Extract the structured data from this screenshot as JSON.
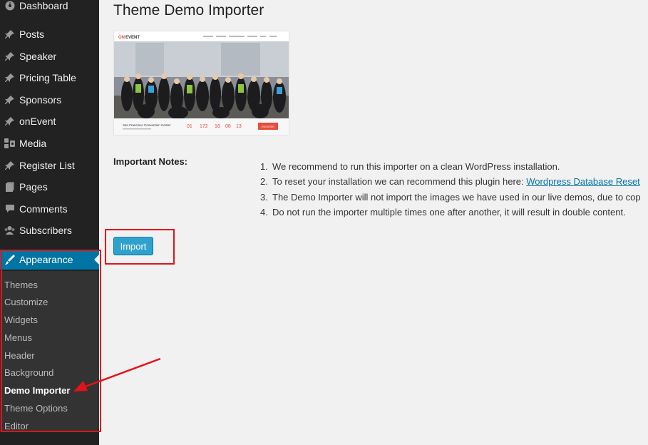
{
  "sidebar": {
    "items": [
      {
        "label": "Dashboard",
        "icon": "dashboard-icon"
      },
      {
        "label": "Posts",
        "icon": "pin-icon"
      },
      {
        "label": "Speaker",
        "icon": "pin-icon"
      },
      {
        "label": "Pricing Table",
        "icon": "pin-icon"
      },
      {
        "label": "Sponsors",
        "icon": "pin-icon"
      },
      {
        "label": "onEvent",
        "icon": "pin-icon"
      },
      {
        "label": "Media",
        "icon": "media-icon"
      },
      {
        "label": "Register List",
        "icon": "pin-icon"
      },
      {
        "label": "Pages",
        "icon": "pages-icon"
      },
      {
        "label": "Comments",
        "icon": "comment-icon"
      },
      {
        "label": "Subscribers",
        "icon": "users-icon"
      }
    ],
    "active": {
      "label": "Appearance",
      "icon": "brush-icon"
    },
    "submenu": [
      {
        "label": "Themes",
        "current": false
      },
      {
        "label": "Customize",
        "current": false
      },
      {
        "label": "Widgets",
        "current": false
      },
      {
        "label": "Menus",
        "current": false
      },
      {
        "label": "Header",
        "current": false
      },
      {
        "label": "Background",
        "current": false
      },
      {
        "label": "Demo Importer",
        "current": true
      },
      {
        "label": "Theme Options",
        "current": false
      },
      {
        "label": "Editor",
        "current": false
      }
    ]
  },
  "main": {
    "title": "Theme Demo Importer",
    "preview": {
      "logo_prefix": "ON",
      "logo_suffix": "EVENT",
      "venue": "San Francisco Convention Center",
      "countdown": [
        "01",
        "172",
        "16",
        "08",
        "13"
      ],
      "cta": "REGISTER"
    },
    "notes_heading": "Important Notes:",
    "notes": [
      {
        "num": "1.",
        "text": "We recommend to run this importer on a clean WordPress installation."
      },
      {
        "num": "2.",
        "text": "To reset your installation we can recommend this plugin here: ",
        "link": "Wordpress Database Reset"
      },
      {
        "num": "3.",
        "text": "The Demo Importer will not import the images we have used in our live demos, due to cop"
      },
      {
        "num": "4.",
        "text": "Do not run the importer multiple times one after another, it will result in double content."
      }
    ],
    "import_label": "Import"
  },
  "colors": {
    "sidebar_bg": "#222222",
    "submenu_bg": "#333333",
    "active_bg": "#0074a2",
    "button_bg": "#2ea2cc",
    "annotation": "#e0141a"
  }
}
